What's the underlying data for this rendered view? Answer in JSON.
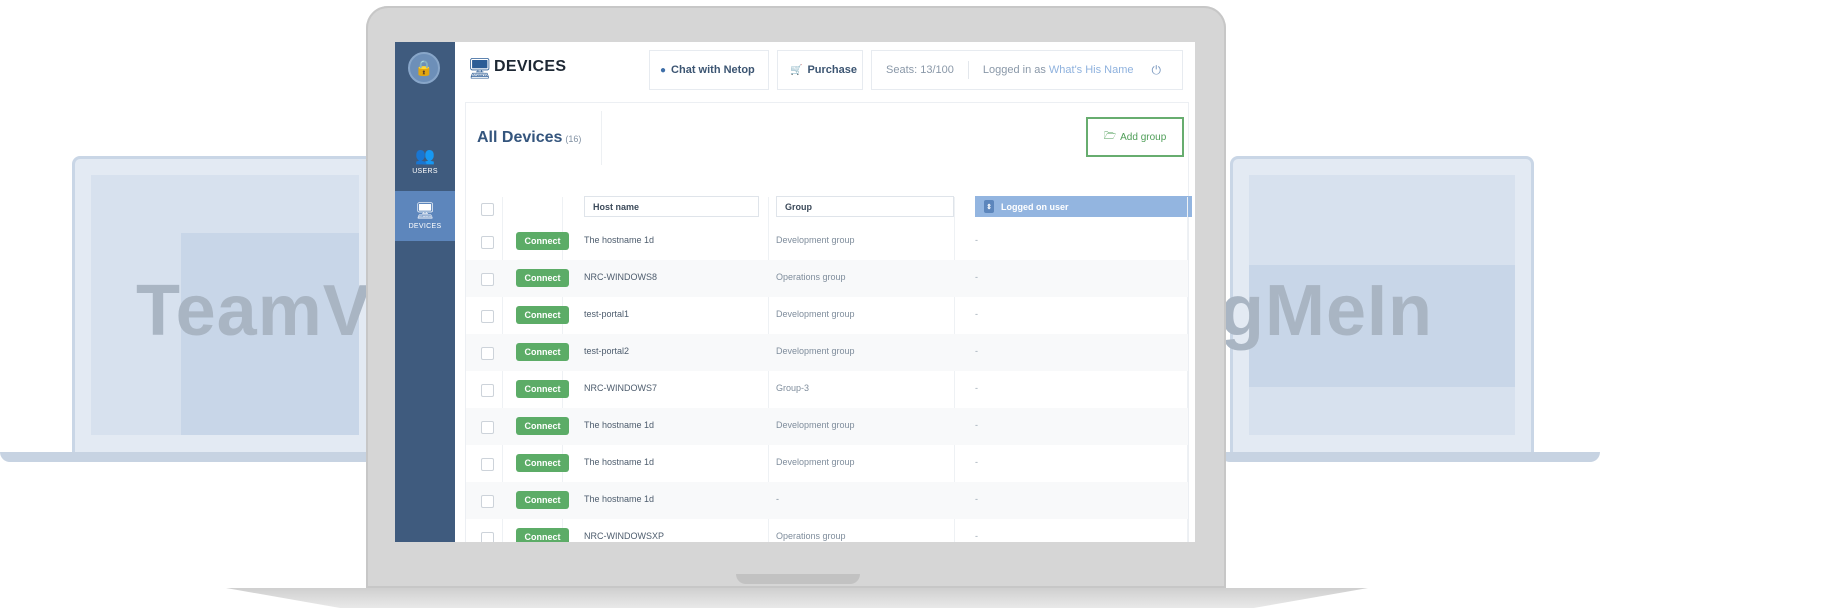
{
  "background": {
    "left_brand": "TeamVi",
    "right_brand": "gMeIn"
  },
  "app": {
    "page_title": "DEVICES",
    "sidebar": [
      {
        "label": "USERS",
        "icon": "users-icon"
      },
      {
        "label": "DEVICES",
        "icon": "monitor-icon",
        "active": true
      }
    ],
    "topbar": {
      "chat_label": "Chat with Netop",
      "purchase_label": "Purchase",
      "seats": "Seats: 13/100",
      "logged_in_prefix": "Logged in as",
      "user_name": "What's His Name"
    },
    "list": {
      "title": "All Devices",
      "count": "(16)",
      "add_group_label": "Add group",
      "columns": {
        "host": "Host name",
        "group": "Group",
        "user": "Logged on user"
      },
      "connect_label": "Connect",
      "rows": [
        {
          "host": "The hostname 1d",
          "group": "Development group",
          "user": "-"
        },
        {
          "host": "NRC-WINDOWS8",
          "group": "Operations group",
          "user": "-"
        },
        {
          "host": "test-portal1",
          "group": "Development group",
          "user": "-"
        },
        {
          "host": "test-portal2",
          "group": "Development group",
          "user": "-"
        },
        {
          "host": "NRC-WINDOWS7",
          "group": "Group-3",
          "user": "-"
        },
        {
          "host": "The hostname 1d",
          "group": "Development group",
          "user": "-"
        },
        {
          "host": "The hostname 1d",
          "group": "Development group",
          "user": "-"
        },
        {
          "host": "The hostname 1d",
          "group": "-",
          "user": "-"
        },
        {
          "host": "NRC-WINDOWSXP",
          "group": "Operations group",
          "user": "-"
        }
      ]
    }
  },
  "colors": {
    "sidebar": "#3f5b7e",
    "sidebar_active": "#5d86bc",
    "connect": "#5cac67",
    "header_active": "#93b5e0"
  }
}
